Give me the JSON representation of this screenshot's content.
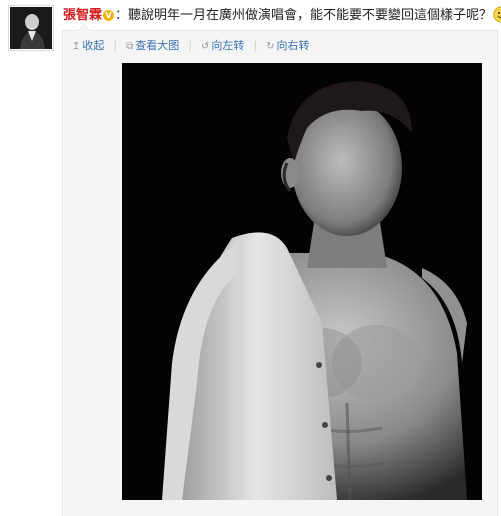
{
  "post": {
    "username": "張智霖",
    "verified_badge": "V",
    "colon": "：",
    "text": "聽說明年一月在廣州做演唱會，能不能要不要變回這個樣子呢？",
    "emoji": [
      "grin-emoji",
      "grin-emoji",
      "grin-emoji"
    ]
  },
  "toolbar": {
    "collapse_label": "收起",
    "view_large_label": "查看大图",
    "rotate_left_label": "向左转",
    "rotate_right_label": "向右转",
    "separator": "|"
  },
  "colors": {
    "username": "#d41c1c",
    "link": "#3b72b8",
    "panel_bg": "#f5f5f5",
    "photo_bg": "#030303",
    "badge": "#f2b400"
  }
}
